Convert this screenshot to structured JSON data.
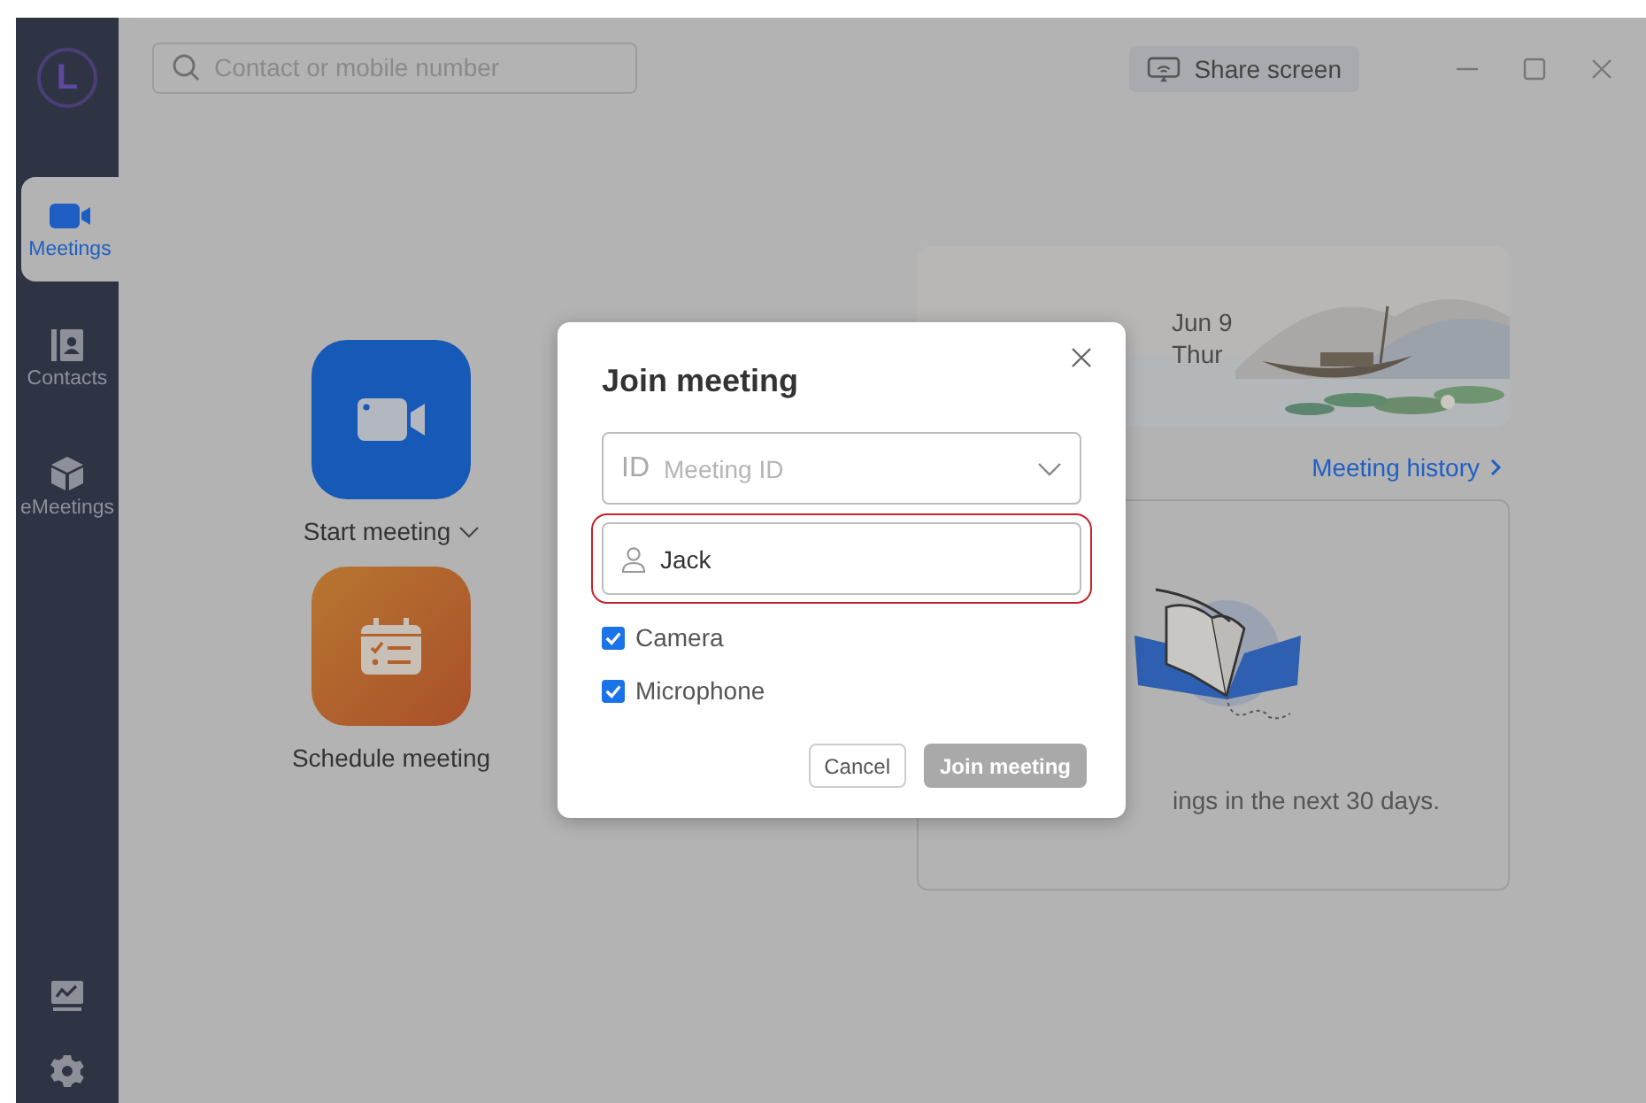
{
  "sidebar": {
    "logo": "L",
    "items": [
      {
        "label": "Meetings",
        "selected": true
      },
      {
        "label": "Contacts",
        "selected": false
      },
      {
        "label": "eMeetings",
        "selected": false
      }
    ]
  },
  "top_bar": {
    "search": {
      "placeholder": "Contact or mobile number"
    },
    "share_button": "Share screen"
  },
  "actions": [
    {
      "label": "Start meeting",
      "dropdown": true
    },
    {
      "label": "Schedule meeting",
      "dropdown": false
    }
  ],
  "clock": {
    "date": "Jun 9",
    "weekday": "Thur"
  },
  "history_link": "Meeting history",
  "empty_message": "ings in the next 30 days.",
  "dialog": {
    "title": "Join meeting",
    "meeting_id": {
      "prefix": "ID",
      "placeholder": "Meeting ID"
    },
    "name": {
      "value": "Jack",
      "highlighted": true
    },
    "options": [
      {
        "label": "Camera",
        "checked": true
      },
      {
        "label": "Microphone",
        "checked": true
      }
    ],
    "buttons": [
      {
        "label": "Cancel",
        "disabled": false
      },
      {
        "label": "Join meeting",
        "disabled": true
      }
    ]
  }
}
